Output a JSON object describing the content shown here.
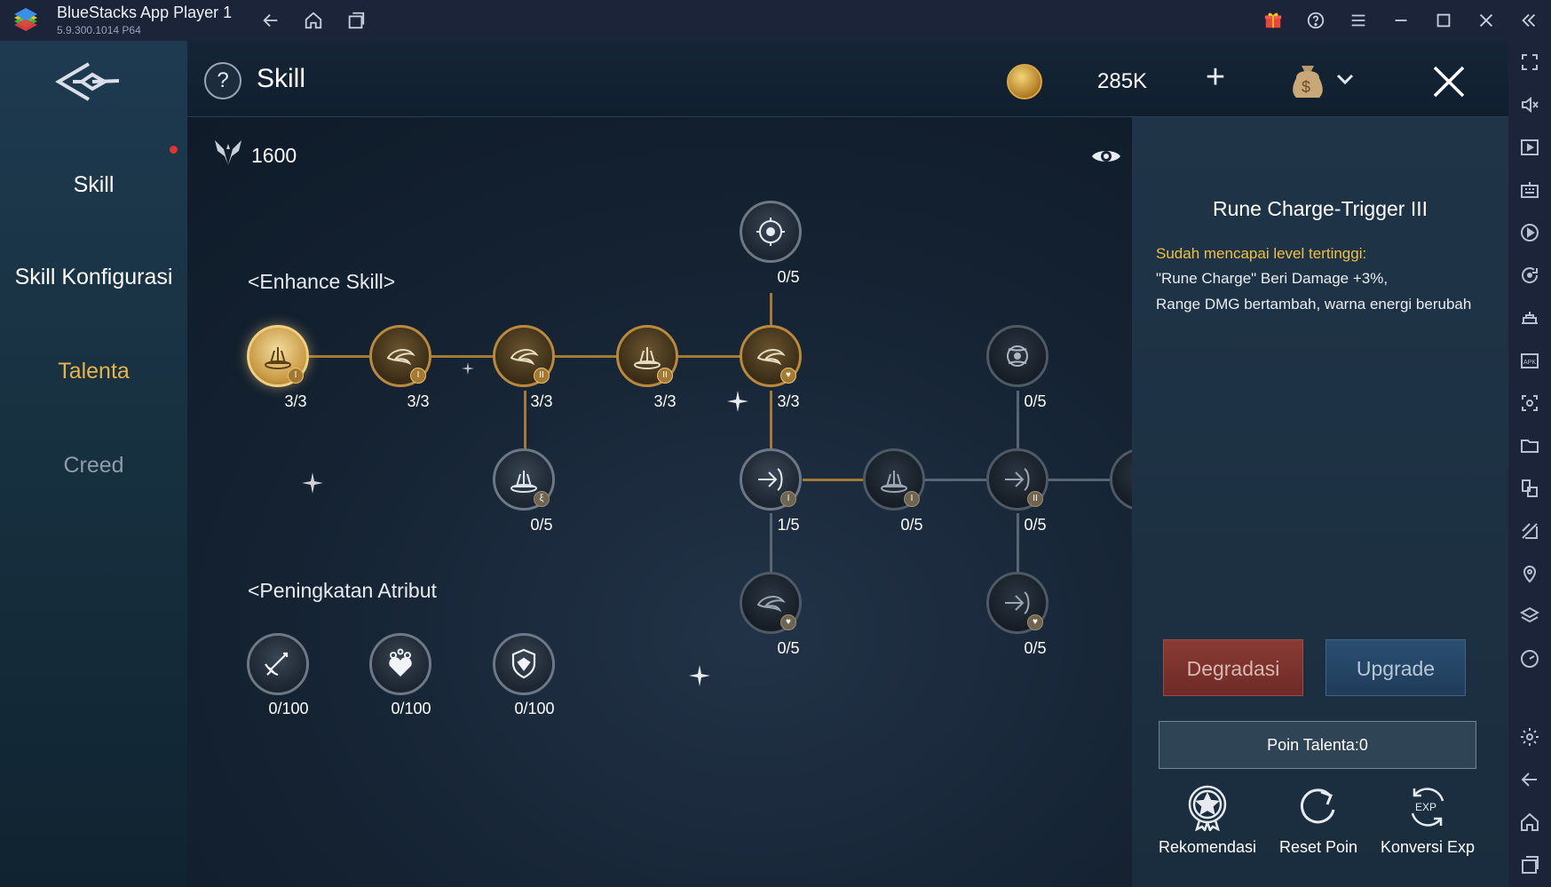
{
  "emulator": {
    "app_title": "BlueStacks App Player 1",
    "version": "5.9.300.1014  P64"
  },
  "nav": {
    "items": [
      {
        "label": "Skill",
        "state": "normal"
      },
      {
        "label": "Skill Konfigurasi",
        "state": "normal"
      },
      {
        "label": "Talenta",
        "state": "active"
      },
      {
        "label": "Creed",
        "state": "dim"
      }
    ]
  },
  "header": {
    "help": "?",
    "title": "Skill",
    "currency_value": "285K",
    "plus": "+"
  },
  "points": {
    "value": "1600"
  },
  "sections": {
    "enhance": "<Enhance Skill>",
    "attribute": "<Peningkatan Atribut"
  },
  "tree": {
    "nodes": [
      {
        "id": "top",
        "label": "0/5",
        "style": "grey"
      },
      {
        "id": "r1c1",
        "label": "3/3",
        "style": "gold-lit"
      },
      {
        "id": "r1c2",
        "label": "3/3",
        "style": "gold"
      },
      {
        "id": "r1c3",
        "label": "3/3",
        "style": "gold"
      },
      {
        "id": "r1c4",
        "label": "3/3",
        "style": "gold"
      },
      {
        "id": "r1c5",
        "label": "3/3",
        "style": "gold"
      },
      {
        "id": "r1c7",
        "label": "0/5",
        "style": "grey-dark"
      },
      {
        "id": "r2c3",
        "label": "0/5",
        "style": "grey"
      },
      {
        "id": "r2c5",
        "label": "1/5",
        "style": "grey"
      },
      {
        "id": "r2c6",
        "label": "0/5",
        "style": "grey-dark"
      },
      {
        "id": "r2c7",
        "label": "0/5",
        "style": "grey-dark"
      },
      {
        "id": "r3c5",
        "label": "0/5",
        "style": "grey-dark"
      },
      {
        "id": "r3c7",
        "label": "0/5",
        "style": "grey-dark"
      }
    ],
    "attributes": [
      {
        "label": "0/100",
        "icon": "sword-icon"
      },
      {
        "label": "0/100",
        "icon": "heart-icon"
      },
      {
        "label": "0/100",
        "icon": "shield-icon"
      }
    ]
  },
  "detail": {
    "title": "Rune Charge-Trigger III",
    "status": "Sudah mencapai level tertinggi:",
    "line1": "\"Rune Charge\" Beri Damage +3%,",
    "line2": "Range DMG bertambah, warna energi berubah",
    "degrade_label": "Degradasi",
    "upgrade_label": "Upgrade",
    "talent_points": "Poin Talenta:0",
    "actions": [
      {
        "label": "Rekomendasi",
        "icon": "star-badge-icon"
      },
      {
        "label": "Reset Poin",
        "icon": "reset-icon"
      },
      {
        "label": "Konversi Exp",
        "icon": "exp-icon"
      }
    ]
  },
  "colors": {
    "accent_gold": "#e8b348",
    "status_yellow": "#f0c040",
    "degrade": "#8a3a34",
    "upgrade": "#2b4f72"
  }
}
